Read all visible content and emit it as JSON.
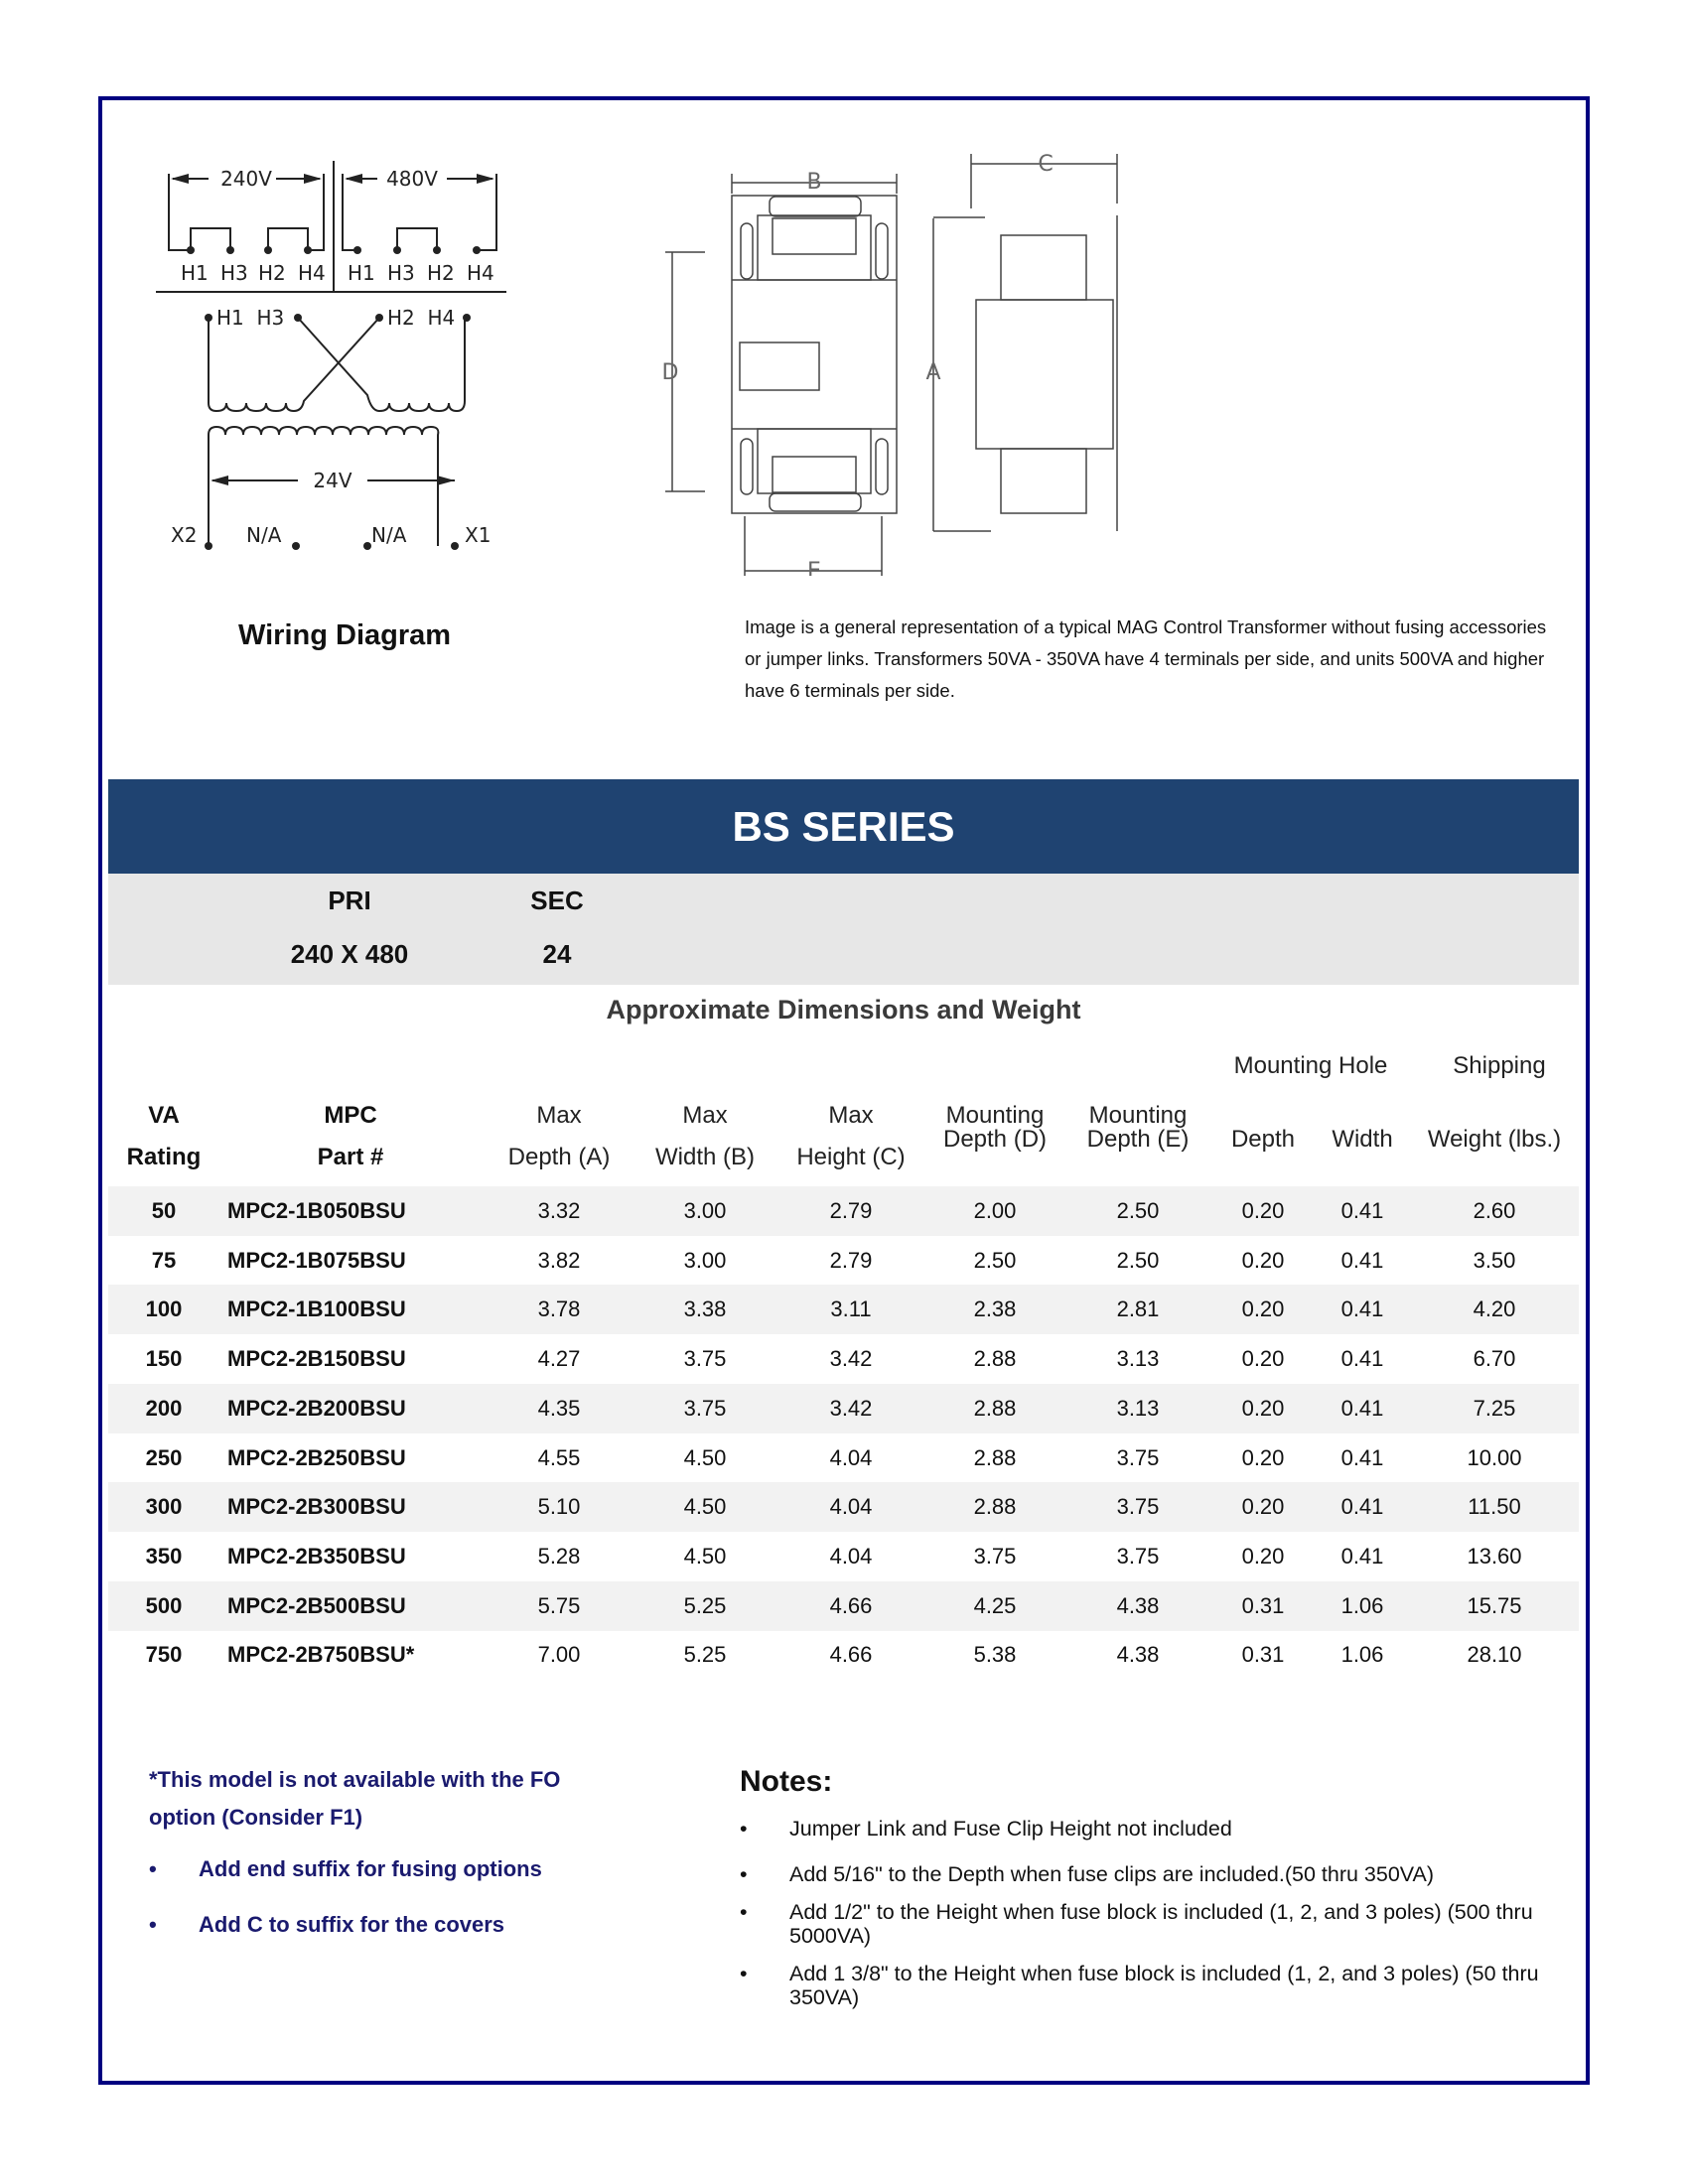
{
  "wiring_diagram": {
    "label": "Wiring Diagram",
    "primary_left_voltage": "240V",
    "primary_right_voltage": "480V",
    "terminal_labels_top": [
      "H1",
      "H3",
      "H2",
      "H4"
    ],
    "coil_labels_left": "H1  H3",
    "coil_labels_right": "H2  H4",
    "secondary_voltage": "24V",
    "secondary_terminals": [
      "X2",
      "N/A",
      "N/A",
      "X1"
    ]
  },
  "dimension_drawing": {
    "labels": [
      "B",
      "D",
      "E",
      "C",
      "A"
    ],
    "caption": "Image is a general representation of a typical MAG Control Transformer  without fusing accessories or jumper links.  Transformers 50VA - 350VA  have 4 terminals per side, and units 500VA and higher have 6 terminals per side."
  },
  "series": {
    "title": "BS SERIES",
    "pri_label": "PRI",
    "sec_label": "SEC",
    "pri_value": "240 X 480",
    "sec_value": "24"
  },
  "table": {
    "title": "Approximate Dimensions and Weight",
    "group_headers": {
      "mounting_hole": "Mounting Hole",
      "shipping": "Shipping"
    },
    "headers": [
      {
        "line1": "VA",
        "line2": "Rating"
      },
      {
        "line1": "MPC",
        "line2": "Part #"
      },
      {
        "line1": "Max",
        "line2": "Depth (A)"
      },
      {
        "line1": "Max",
        "line2": "Width (B)"
      },
      {
        "line1": "Max",
        "line2": "Height (C)"
      },
      {
        "line1": "Mounting",
        "line2": "Depth (D)"
      },
      {
        "line1": "Mounting",
        "line2": "Depth (E)"
      },
      {
        "line1": "",
        "line2": "Depth"
      },
      {
        "line1": "",
        "line2": "Width"
      },
      {
        "line1": "",
        "line2": "Weight (lbs.)"
      }
    ],
    "rows": [
      [
        "50",
        "MPC2-1B050BSU",
        "3.32",
        "3.00",
        "2.79",
        "2.00",
        "2.50",
        "0.20",
        "0.41",
        "2.60"
      ],
      [
        "75",
        "MPC2-1B075BSU",
        "3.82",
        "3.00",
        "2.79",
        "2.50",
        "2.50",
        "0.20",
        "0.41",
        "3.50"
      ],
      [
        "100",
        "MPC2-1B100BSU",
        "3.78",
        "3.38",
        "3.11",
        "2.38",
        "2.81",
        "0.20",
        "0.41",
        "4.20"
      ],
      [
        "150",
        "MPC2-2B150BSU",
        "4.27",
        "3.75",
        "3.42",
        "2.88",
        "3.13",
        "0.20",
        "0.41",
        "6.70"
      ],
      [
        "200",
        "MPC2-2B200BSU",
        "4.35",
        "3.75",
        "3.42",
        "2.88",
        "3.13",
        "0.20",
        "0.41",
        "7.25"
      ],
      [
        "250",
        "MPC2-2B250BSU",
        "4.55",
        "4.50",
        "4.04",
        "2.88",
        "3.75",
        "0.20",
        "0.41",
        "10.00"
      ],
      [
        "300",
        "MPC2-2B300BSU",
        "5.10",
        "4.50",
        "4.04",
        "2.88",
        "3.75",
        "0.20",
        "0.41",
        "11.50"
      ],
      [
        "350",
        "MPC2-2B350BSU",
        "5.28",
        "4.50",
        "4.04",
        "3.75",
        "3.75",
        "0.20",
        "0.41",
        "13.60"
      ],
      [
        "500",
        "MPC2-2B500BSU",
        "5.75",
        "5.25",
        "4.66",
        "4.25",
        "4.38",
        "0.31",
        "1.06",
        "15.75"
      ],
      [
        "750",
        "MPC2-2B750BSU*",
        "7.00",
        "5.25",
        "4.66",
        "5.38",
        "4.38",
        "0.31",
        "1.06",
        "28.10"
      ]
    ]
  },
  "footnotes": {
    "asterisk_line1": "*This model is not available with the FO",
    "asterisk_line2": "option (Consider F1)",
    "bullets": [
      "Add end suffix for fusing options",
      "Add C to suffix for the covers"
    ]
  },
  "notes": {
    "title": "Notes:",
    "bullet_symbol": "•",
    "items": [
      "Jumper Link and Fuse Clip Height not included",
      "Add 5/16\" to the Depth when fuse clips are included.(50 thru 350VA)",
      "Add 1/2\" to the Height when fuse block is included (1, 2, and 3 poles) (500 thru 5000VA)",
      "Add 1 3/8\" to the Height when fuse block is included (1, 2, and 3 poles) (50 thru 350VA)"
    ]
  },
  "colors": {
    "frame_border": "#000080",
    "series_band": "#1f4371",
    "gray_band": "#e7e7e7",
    "row_shade": "#f2f2f2",
    "footnote_text": "#1a1a6e"
  }
}
